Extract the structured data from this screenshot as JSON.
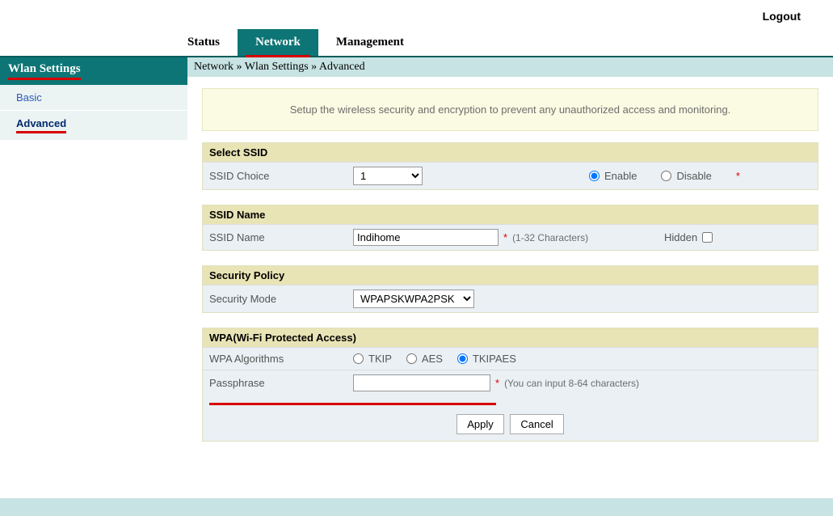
{
  "header": {
    "logout": "Logout"
  },
  "tabs": {
    "status": "Status",
    "network": "Network",
    "management": "Management"
  },
  "sidebar": {
    "title": "Wlan Settings",
    "items": {
      "basic": "Basic",
      "advanced": "Advanced"
    }
  },
  "breadcrumb": "Network » Wlan Settings » Advanced",
  "intro": "Setup the wireless security and encryption to prevent any unauthorized access and monitoring.",
  "sections": {
    "select_ssid": {
      "title": "Select SSID",
      "label": "SSID Choice",
      "choice_value": "1",
      "enable": "Enable",
      "disable": "Disable"
    },
    "ssid_name": {
      "title": "SSID Name",
      "label": "SSID Name",
      "value": "Indihome",
      "hint": "(1-32 Characters)",
      "hidden_label": "Hidden"
    },
    "security": {
      "title": "Security Policy",
      "label": "Security Mode",
      "value": "WPAPSKWPA2PSK"
    },
    "wpa": {
      "title": "WPA(Wi-Fi Protected Access)",
      "algo_label": "WPA Algorithms",
      "tkip": "TKIP",
      "aes": "AES",
      "tkipaes": "TKIPAES",
      "pass_label": "Passphrase",
      "pass_hint": "(You can input 8-64 characters)"
    }
  },
  "buttons": {
    "apply": "Apply",
    "cancel": "Cancel"
  }
}
